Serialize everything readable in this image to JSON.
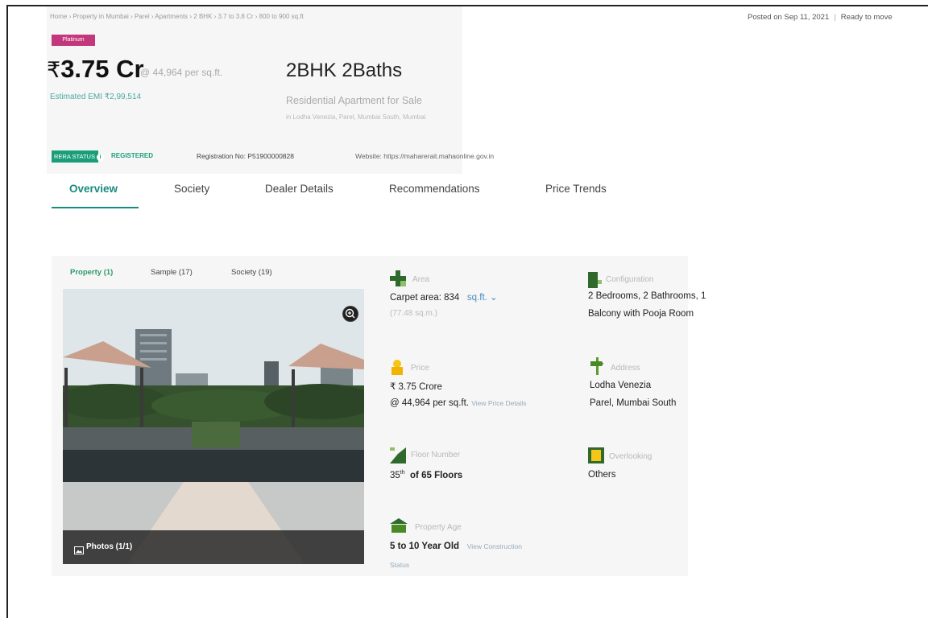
{
  "breadcrumb": "Home › Property in Mumbai › Parel › Apartments › 2 BHK › 3.7 to 3.8 Cr › 800 to 900 sq.ft",
  "posted": {
    "date": "Posted on Sep 11, 2021",
    "status": "Ready to move"
  },
  "badge": "Platinum",
  "price": {
    "currency": "₹",
    "amount": "3.75 Cr",
    "per_sqft": "@ 44,964 per sq.ft.",
    "emi": "Estimated EMI ₹2,99,514"
  },
  "listing": {
    "title": "2BHK 2Baths",
    "subtitle": "Residential Apartment for Sale",
    "locality": "in Lodha Venezia, Parel, Mumbai South, Mumbai"
  },
  "rera": {
    "status_label": "RERA STATUS",
    "info_glyph": "i",
    "registered": "REGISTERED",
    "registration": "Registration No: P51900000828",
    "website": "Website: https://maharerait.mahaonline.gov.in"
  },
  "tabs": [
    "Overview",
    "Society",
    "Dealer Details",
    "Recommendations",
    "Price Trends"
  ],
  "gallery_tabs": [
    "Property (1)",
    "Sample (17)",
    "Society (19)"
  ],
  "photos_label": "Photos (1/1)",
  "details": {
    "area": {
      "label": "Area",
      "value": "Carpet area: 834",
      "unit": "sq.ft.",
      "sub": "(77.48 sq.m.)"
    },
    "configuration": {
      "label": "Configuration",
      "line1": "2 Bedrooms, 2 Bathrooms, 1",
      "line2": "Balcony with Pooja Room"
    },
    "price": {
      "label": "Price",
      "line1": "₹ 3.75 Crore",
      "line2": "@ 44,964 per sq.ft.",
      "link": "View Price Details"
    },
    "address": {
      "label": "Address",
      "line1": "Lodha Venezia",
      "line2": "Parel, Mumbai South"
    },
    "floor": {
      "label": "Floor Number",
      "value": "35",
      "sup": "th",
      "rest": "of 65 Floors"
    },
    "overlooking": {
      "label": "Overlooking",
      "value": "Others"
    },
    "age": {
      "label": "Property Age",
      "value": "5 to 10 Year Old",
      "link": "View Construction",
      "link2": "Status"
    }
  },
  "colors": {
    "accent": "#1a8a80",
    "badge": "#c3387c",
    "rera": "#1a9e7a"
  }
}
